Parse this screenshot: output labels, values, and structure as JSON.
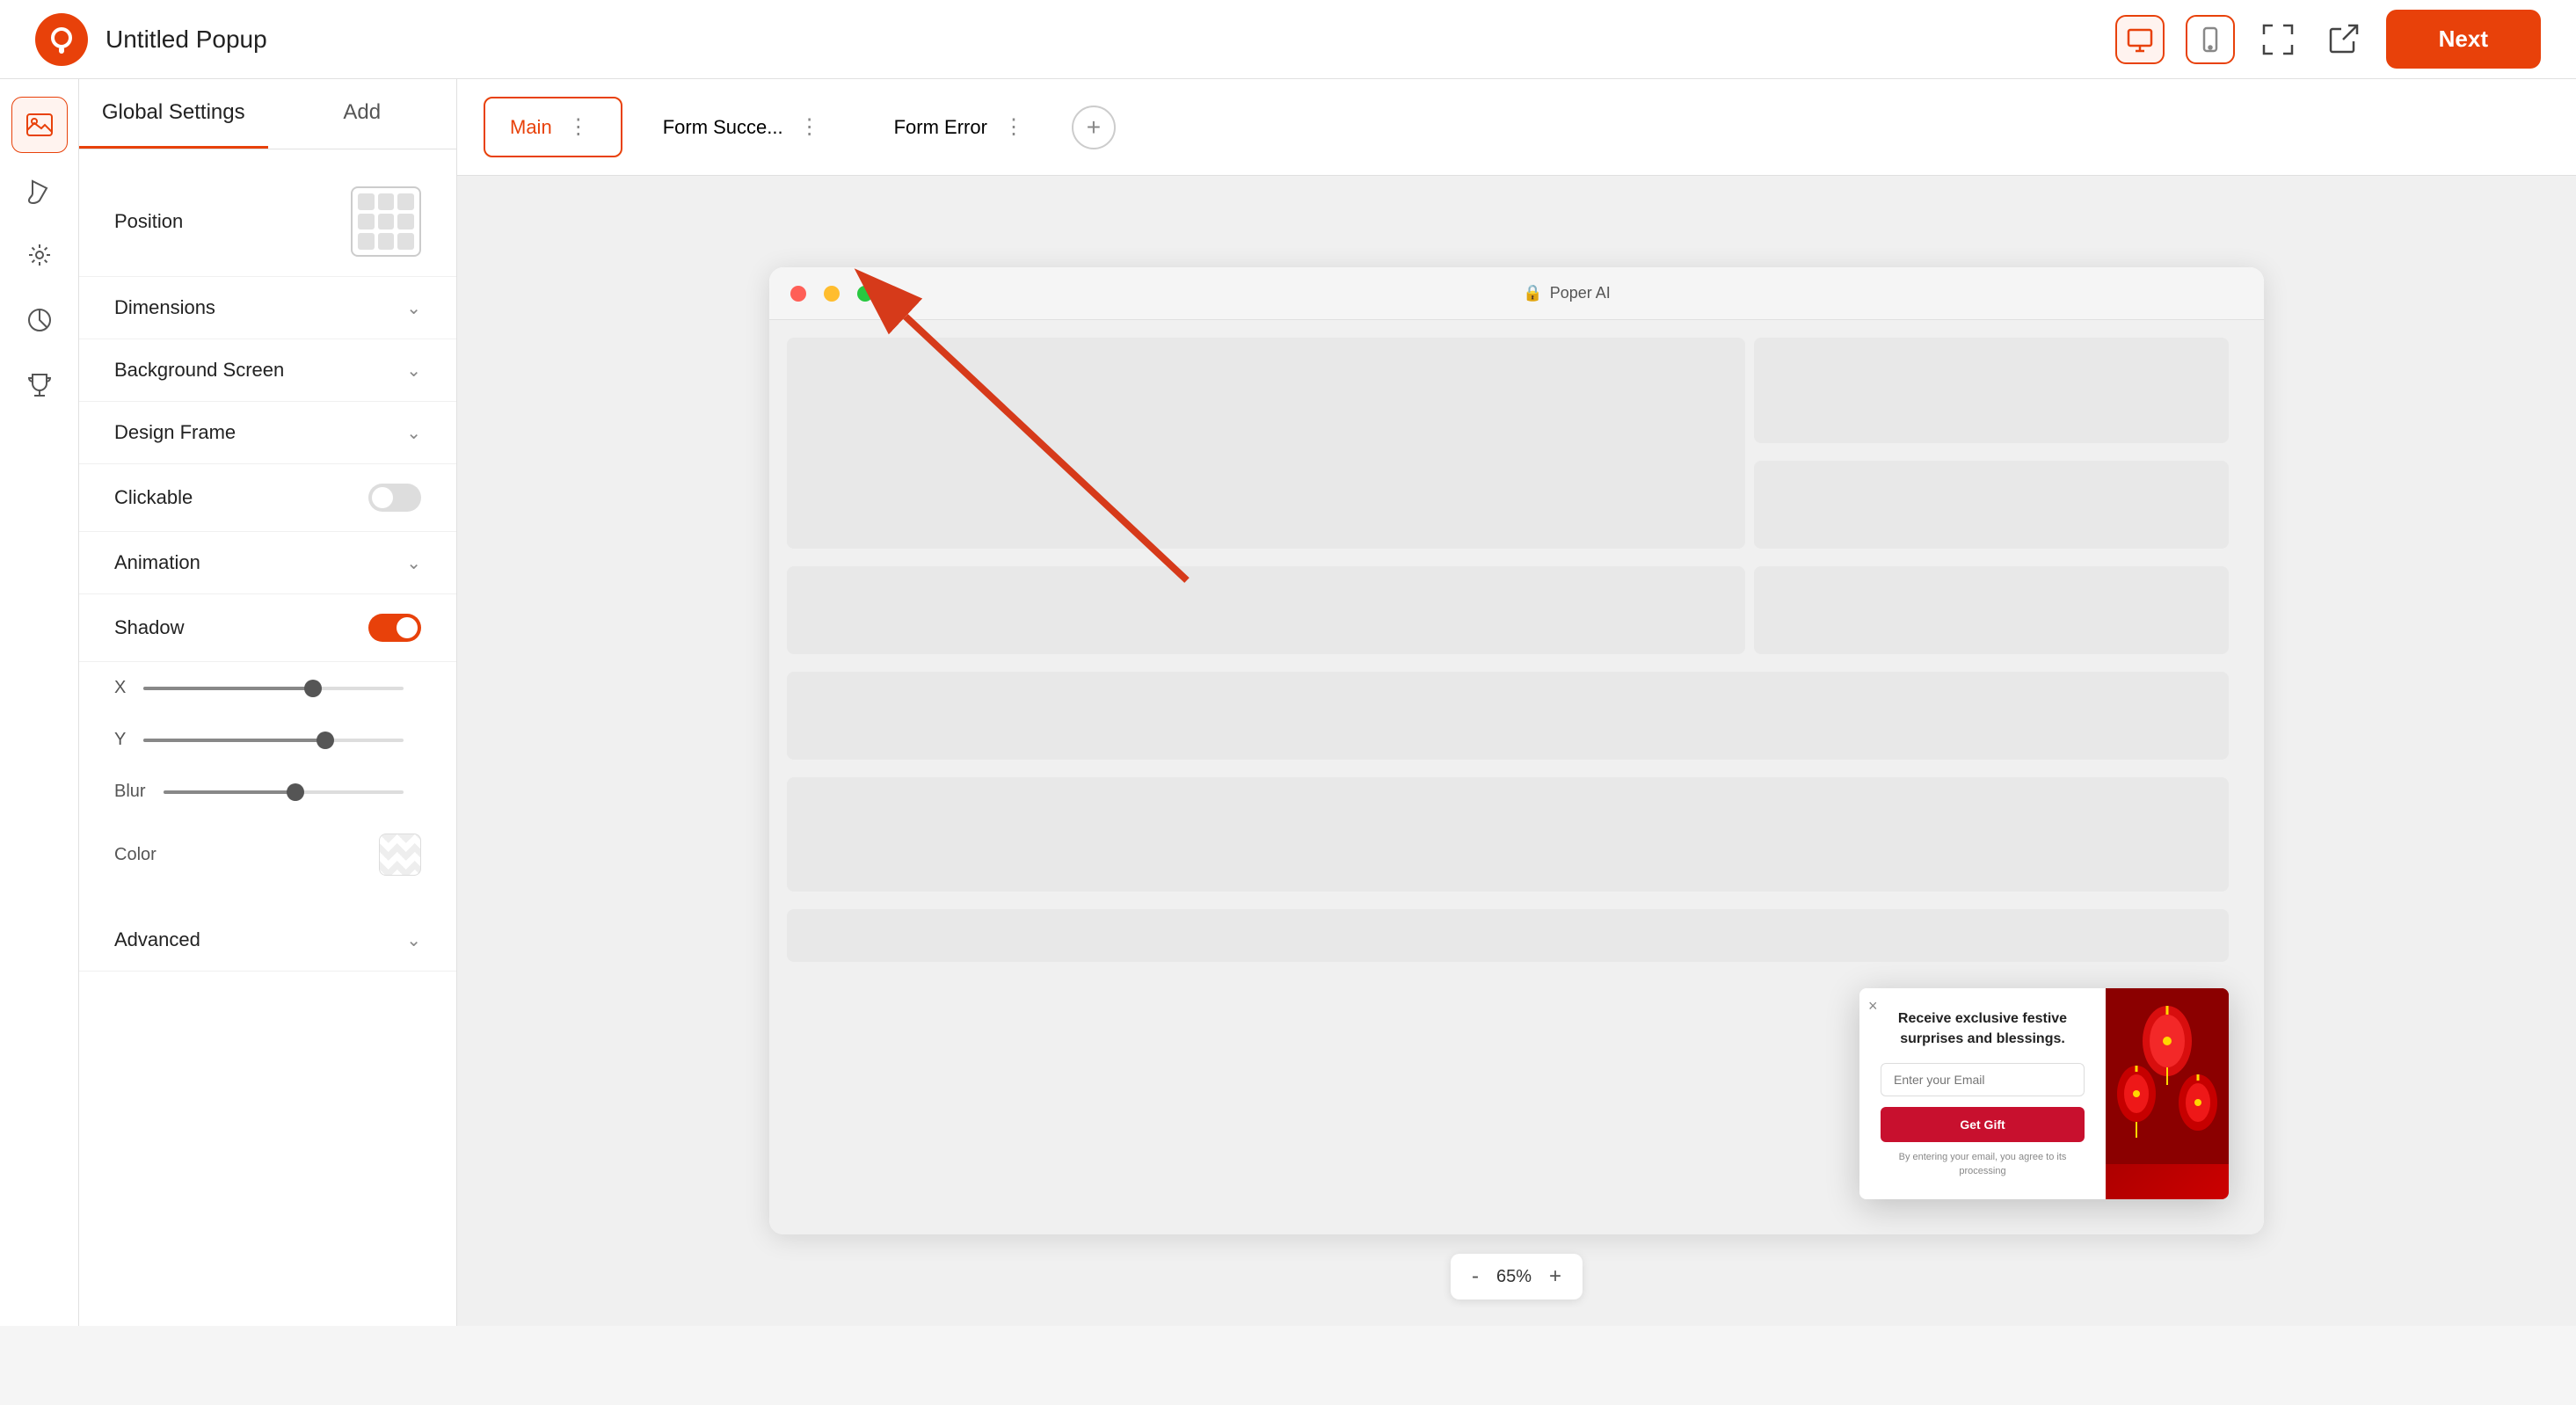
{
  "header": {
    "app_title": "Untitled Popup",
    "next_label": "Next"
  },
  "panel": {
    "tab_global": "Global Settings",
    "tab_add": "Add",
    "position_label": "Position",
    "dimensions_label": "Dimensions",
    "background_screen_label": "Background Screen",
    "design_frame_label": "Design Frame",
    "clickable_label": "Clickable",
    "animation_label": "Animation",
    "shadow_label": "Shadow",
    "shadow_enabled": true,
    "clickable_enabled": false,
    "x_label": "X",
    "y_label": "Y",
    "blur_label": "Blur",
    "color_label": "Color",
    "advanced_label": "Advanced",
    "x_value": 65,
    "y_value": 70,
    "blur_value": 55
  },
  "canvas": {
    "tabs": [
      {
        "label": "Main",
        "active": true
      },
      {
        "label": "Form Succe...",
        "active": false
      },
      {
        "label": "Form Error",
        "active": false
      }
    ],
    "add_tab": "+",
    "zoom_value": "65%",
    "zoom_minus": "-",
    "zoom_plus": "+"
  },
  "browser": {
    "url_text": "Poper AI",
    "lock_icon": "🔒"
  },
  "popup": {
    "close": "×",
    "title": "Receive exclusive festive surprises and blessings.",
    "email_placeholder": "Enter your Email",
    "button_label": "Get Gift",
    "disclaimer": "By entering your email, you agree to its processing"
  }
}
